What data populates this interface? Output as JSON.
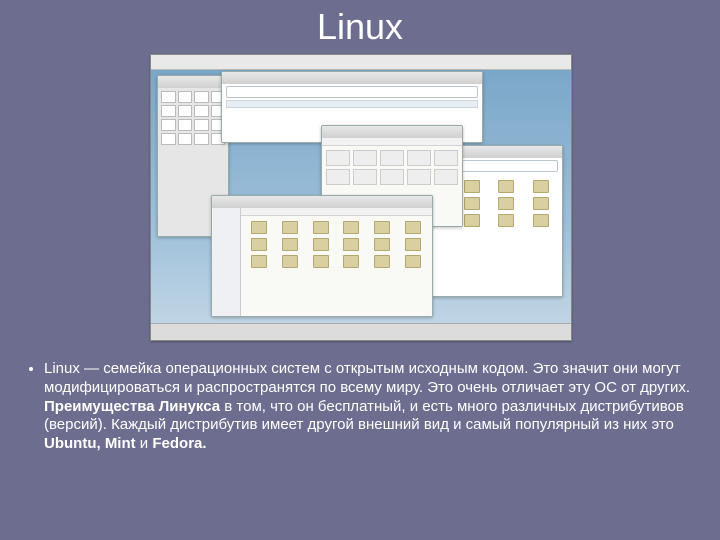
{
  "title": "Linux",
  "body": {
    "p1": "Linux — семейка операционных систем с открытым исходным кодом. Это значит они могут модифицироваться и распространятся по всему миру. Это очень отличает эту ОС от других. ",
    "b1": "Преимущества Линукса",
    "p2": " в том, что он бесплатный, и есть много различных дистрибутивов (версий). Каждый дистрибутив имеет другой внешний вид и самый популярный из них это ",
    "b2": "Ubuntu, Mint",
    "p3": " и ",
    "b3": "Fedora."
  }
}
